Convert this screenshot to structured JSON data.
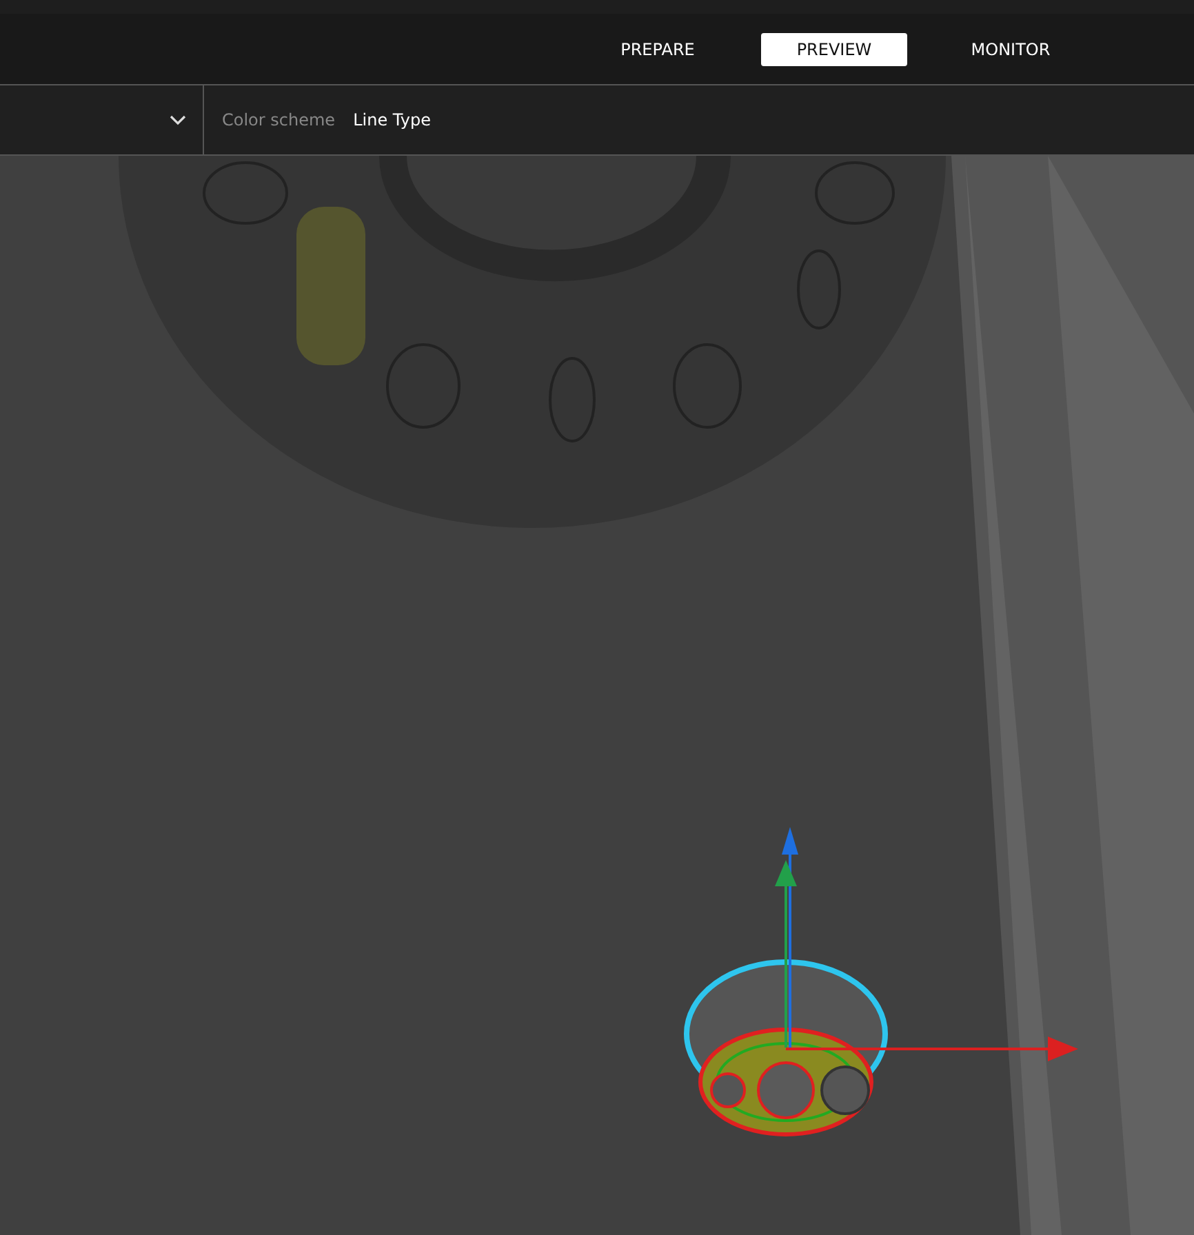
{
  "stage_tabs": [
    {
      "label": "PREPARE",
      "selected": false
    },
    {
      "label": "PREVIEW",
      "selected": true
    },
    {
      "label": "MONITOR",
      "selected": false
    }
  ],
  "view_toolbar": {
    "color_scheme_label": "Color scheme",
    "color_scheme_value": "Line Type"
  }
}
